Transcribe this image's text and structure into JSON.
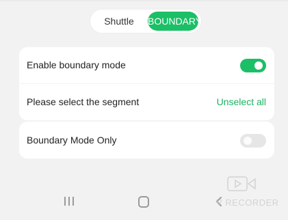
{
  "segmented_control": {
    "options": [
      "Shuttle",
      "BOUNDARY"
    ],
    "selected": "BOUNDARY"
  },
  "settings": {
    "boundary_mode": {
      "label": "Enable boundary mode",
      "enabled": true
    },
    "segment_select": {
      "label": "Please select the segment",
      "action_label": "Unselect all"
    },
    "boundary_only": {
      "label": "Boundary Mode Only",
      "enabled": false
    }
  },
  "watermark": {
    "text": "V RECORDER"
  },
  "colors": {
    "accent": "#1bbf66",
    "link": "#1bb262",
    "background": "#f2f2f2",
    "card": "#ffffff",
    "toggle_off": "#e6e6e6"
  },
  "icons": [
    "recents-icon",
    "home-icon",
    "back-icon",
    "recorder-icon"
  ]
}
